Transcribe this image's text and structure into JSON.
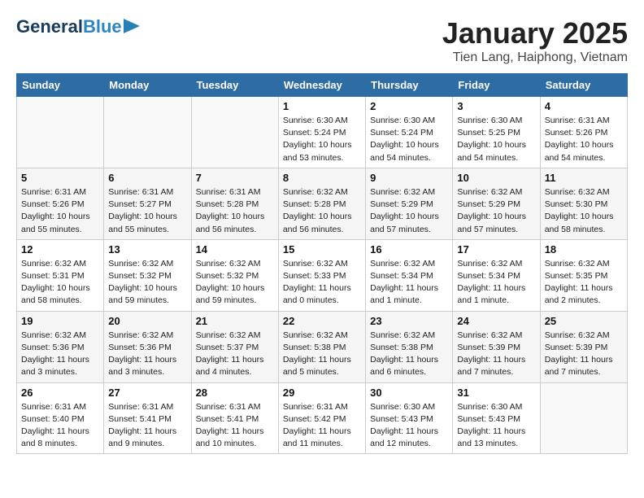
{
  "header": {
    "logo_general": "General",
    "logo_blue": "Blue",
    "month_title": "January 2025",
    "subtitle": "Tien Lang, Haiphong, Vietnam"
  },
  "days_of_week": [
    "Sunday",
    "Monday",
    "Tuesday",
    "Wednesday",
    "Thursday",
    "Friday",
    "Saturday"
  ],
  "weeks": [
    [
      {
        "day": "",
        "info": ""
      },
      {
        "day": "",
        "info": ""
      },
      {
        "day": "",
        "info": ""
      },
      {
        "day": "1",
        "info": "Sunrise: 6:30 AM\nSunset: 5:24 PM\nDaylight: 10 hours\nand 53 minutes."
      },
      {
        "day": "2",
        "info": "Sunrise: 6:30 AM\nSunset: 5:24 PM\nDaylight: 10 hours\nand 54 minutes."
      },
      {
        "day": "3",
        "info": "Sunrise: 6:30 AM\nSunset: 5:25 PM\nDaylight: 10 hours\nand 54 minutes."
      },
      {
        "day": "4",
        "info": "Sunrise: 6:31 AM\nSunset: 5:26 PM\nDaylight: 10 hours\nand 54 minutes."
      }
    ],
    [
      {
        "day": "5",
        "info": "Sunrise: 6:31 AM\nSunset: 5:26 PM\nDaylight: 10 hours\nand 55 minutes."
      },
      {
        "day": "6",
        "info": "Sunrise: 6:31 AM\nSunset: 5:27 PM\nDaylight: 10 hours\nand 55 minutes."
      },
      {
        "day": "7",
        "info": "Sunrise: 6:31 AM\nSunset: 5:28 PM\nDaylight: 10 hours\nand 56 minutes."
      },
      {
        "day": "8",
        "info": "Sunrise: 6:32 AM\nSunset: 5:28 PM\nDaylight: 10 hours\nand 56 minutes."
      },
      {
        "day": "9",
        "info": "Sunrise: 6:32 AM\nSunset: 5:29 PM\nDaylight: 10 hours\nand 57 minutes."
      },
      {
        "day": "10",
        "info": "Sunrise: 6:32 AM\nSunset: 5:29 PM\nDaylight: 10 hours\nand 57 minutes."
      },
      {
        "day": "11",
        "info": "Sunrise: 6:32 AM\nSunset: 5:30 PM\nDaylight: 10 hours\nand 58 minutes."
      }
    ],
    [
      {
        "day": "12",
        "info": "Sunrise: 6:32 AM\nSunset: 5:31 PM\nDaylight: 10 hours\nand 58 minutes."
      },
      {
        "day": "13",
        "info": "Sunrise: 6:32 AM\nSunset: 5:32 PM\nDaylight: 10 hours\nand 59 minutes."
      },
      {
        "day": "14",
        "info": "Sunrise: 6:32 AM\nSunset: 5:32 PM\nDaylight: 10 hours\nand 59 minutes."
      },
      {
        "day": "15",
        "info": "Sunrise: 6:32 AM\nSunset: 5:33 PM\nDaylight: 11 hours\nand 0 minutes."
      },
      {
        "day": "16",
        "info": "Sunrise: 6:32 AM\nSunset: 5:34 PM\nDaylight: 11 hours\nand 1 minute."
      },
      {
        "day": "17",
        "info": "Sunrise: 6:32 AM\nSunset: 5:34 PM\nDaylight: 11 hours\nand 1 minute."
      },
      {
        "day": "18",
        "info": "Sunrise: 6:32 AM\nSunset: 5:35 PM\nDaylight: 11 hours\nand 2 minutes."
      }
    ],
    [
      {
        "day": "19",
        "info": "Sunrise: 6:32 AM\nSunset: 5:36 PM\nDaylight: 11 hours\nand 3 minutes."
      },
      {
        "day": "20",
        "info": "Sunrise: 6:32 AM\nSunset: 5:36 PM\nDaylight: 11 hours\nand 3 minutes."
      },
      {
        "day": "21",
        "info": "Sunrise: 6:32 AM\nSunset: 5:37 PM\nDaylight: 11 hours\nand 4 minutes."
      },
      {
        "day": "22",
        "info": "Sunrise: 6:32 AM\nSunset: 5:38 PM\nDaylight: 11 hours\nand 5 minutes."
      },
      {
        "day": "23",
        "info": "Sunrise: 6:32 AM\nSunset: 5:38 PM\nDaylight: 11 hours\nand 6 minutes."
      },
      {
        "day": "24",
        "info": "Sunrise: 6:32 AM\nSunset: 5:39 PM\nDaylight: 11 hours\nand 7 minutes."
      },
      {
        "day": "25",
        "info": "Sunrise: 6:32 AM\nSunset: 5:39 PM\nDaylight: 11 hours\nand 7 minutes."
      }
    ],
    [
      {
        "day": "26",
        "info": "Sunrise: 6:31 AM\nSunset: 5:40 PM\nDaylight: 11 hours\nand 8 minutes."
      },
      {
        "day": "27",
        "info": "Sunrise: 6:31 AM\nSunset: 5:41 PM\nDaylight: 11 hours\nand 9 minutes."
      },
      {
        "day": "28",
        "info": "Sunrise: 6:31 AM\nSunset: 5:41 PM\nDaylight: 11 hours\nand 10 minutes."
      },
      {
        "day": "29",
        "info": "Sunrise: 6:31 AM\nSunset: 5:42 PM\nDaylight: 11 hours\nand 11 minutes."
      },
      {
        "day": "30",
        "info": "Sunrise: 6:30 AM\nSunset: 5:43 PM\nDaylight: 11 hours\nand 12 minutes."
      },
      {
        "day": "31",
        "info": "Sunrise: 6:30 AM\nSunset: 5:43 PM\nDaylight: 11 hours\nand 13 minutes."
      },
      {
        "day": "",
        "info": ""
      }
    ]
  ]
}
